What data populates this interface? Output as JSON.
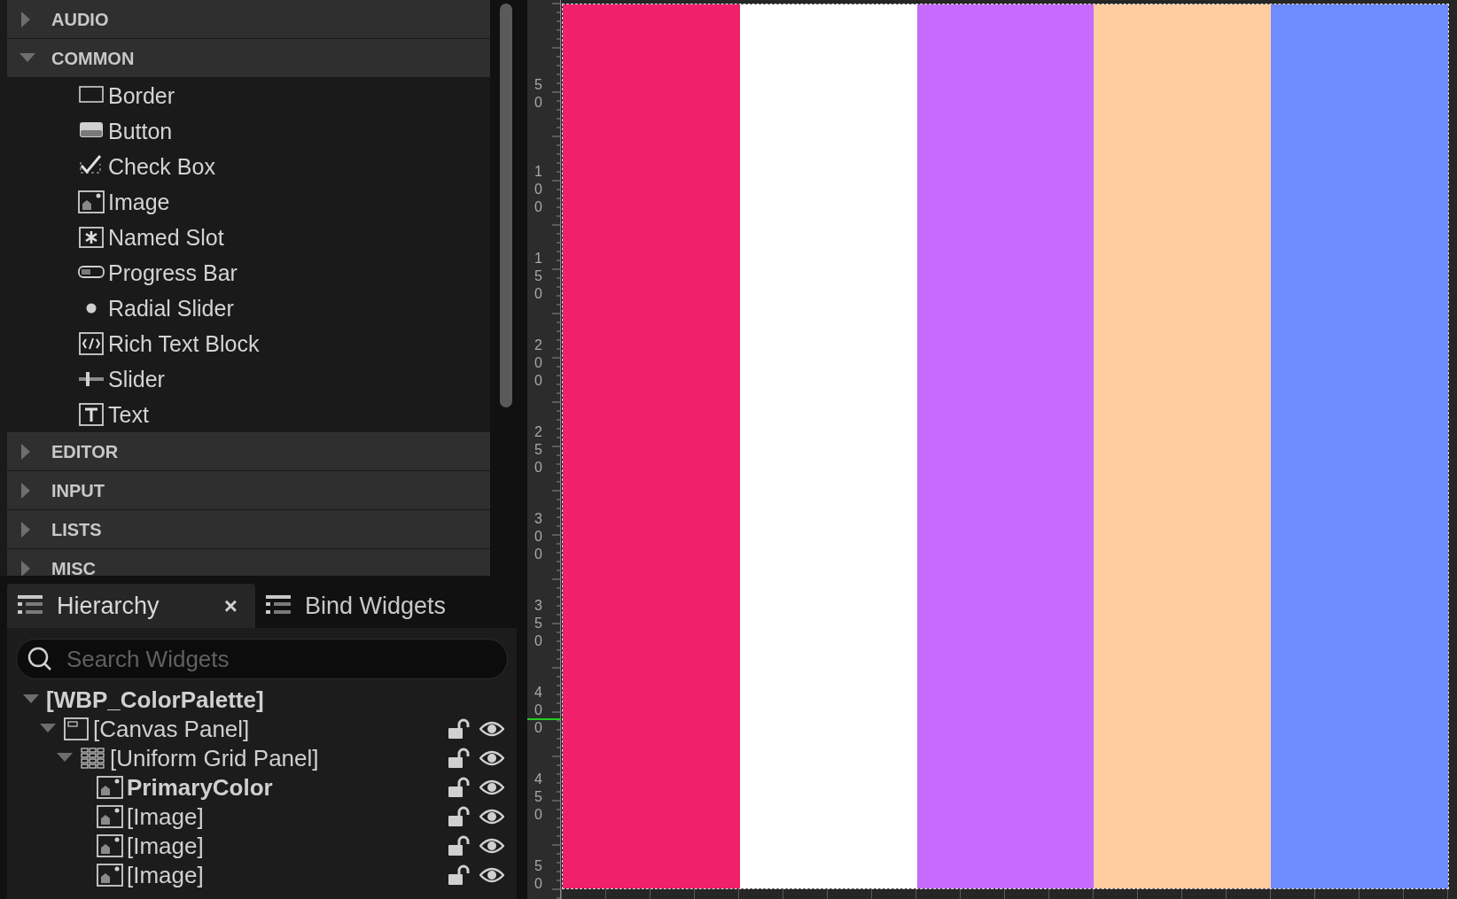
{
  "palette": [
    {
      "label": "AUDIO",
      "expanded": false
    },
    {
      "label": "COMMON",
      "expanded": true,
      "children": [
        {
          "label": "Border",
          "kind": "border"
        },
        {
          "label": "Button",
          "kind": "button"
        },
        {
          "label": "Check Box",
          "kind": "checkbox"
        },
        {
          "label": "Image",
          "kind": "image"
        },
        {
          "label": "Named Slot",
          "kind": "slot"
        },
        {
          "label": "Progress Bar",
          "kind": "progress"
        },
        {
          "label": "Radial Slider",
          "kind": "radial"
        },
        {
          "label": "Rich Text Block",
          "kind": "richtext"
        },
        {
          "label": "Slider",
          "kind": "slider"
        },
        {
          "label": "Text",
          "kind": "text"
        }
      ]
    },
    {
      "label": "EDITOR",
      "expanded": false
    },
    {
      "label": "INPUT",
      "expanded": false
    },
    {
      "label": "LISTS",
      "expanded": false
    },
    {
      "label": "MISC",
      "expanded": false
    }
  ],
  "panel_tabs": [
    {
      "label": "Hierarchy",
      "selected": true,
      "close": "×"
    },
    {
      "label": "Bind Widgets",
      "selected": false
    }
  ],
  "search": {
    "placeholder": "Search Widgets"
  },
  "tree": [
    {
      "label": "[WBP_ColorPalette]",
      "bold": true,
      "expanded": true,
      "children": [
        {
          "label": "[Canvas Panel]",
          "kind": "canvas",
          "bold": false,
          "expanded": true,
          "locked": false,
          "visible": true,
          "children": [
            {
              "label": "[Uniform Grid Panel]",
              "kind": "grid",
              "bold": false,
              "expanded": true,
              "locked": false,
              "visible": true,
              "children": [
                {
                  "label": "PrimaryColor",
                  "kind": "image",
                  "bold": true,
                  "locked": false,
                  "visible": true
                },
                {
                  "label": "[Image]",
                  "kind": "image",
                  "bold": false,
                  "locked": false,
                  "visible": true
                },
                {
                  "label": "[Image]",
                  "kind": "image",
                  "bold": false,
                  "locked": false,
                  "visible": true
                },
                {
                  "label": "[Image]",
                  "kind": "image",
                  "bold": false,
                  "locked": false,
                  "visible": true
                }
              ]
            }
          ]
        }
      ]
    }
  ],
  "ruler": {
    "labels": [
      "50",
      "100",
      "150",
      "200",
      "250",
      "300",
      "350",
      "400",
      "450",
      "50"
    ]
  },
  "swatches": [
    {
      "color": "#f0206a"
    },
    {
      "color": "#ffffff"
    },
    {
      "color": "#c66bfd"
    },
    {
      "color": "#ffcda0"
    },
    {
      "color": "#6f8cfe"
    }
  ]
}
